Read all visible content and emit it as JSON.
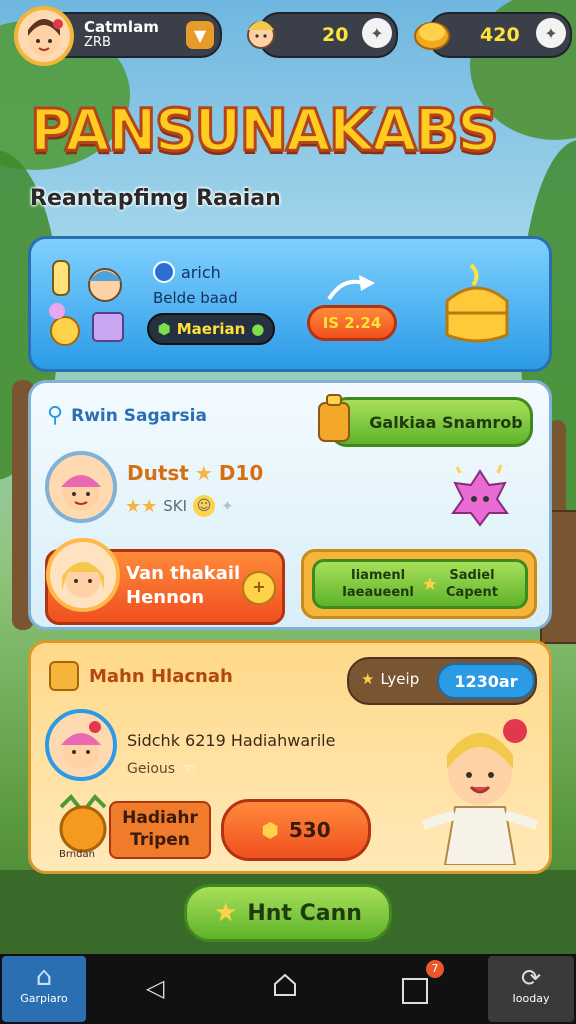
{
  "hud": {
    "player_name": "Catmlam",
    "player_sub": "ZRB",
    "counter1_value": "20",
    "counter2_value": "420"
  },
  "title": "PANSUNAKABS",
  "subtitle": "Reantapfimg Raaian",
  "panel1": {
    "label1": "arich",
    "label2": "Belde baad",
    "badge_label": "Maerian",
    "price_label": "IS 2.24"
  },
  "panel2": {
    "heading": "Rwin Sagarsia",
    "green_button": "Galkiaa Snamrob",
    "player_name": "Dutst",
    "player_level": "D10",
    "player_small": "SKI",
    "orange_card_line1": "Van thakail",
    "orange_card_line2": "Hennon",
    "dual_btn_left_line1": "Iiamenl",
    "dual_btn_left_line2": "Iaeaueenl",
    "dual_btn_right_line1": "Sadiel",
    "dual_btn_right_line2": "Capent"
  },
  "panel3": {
    "heading": "Mahn Hlacnah",
    "pill_left": "Lyeip",
    "pill_right": "1230ar",
    "line1": "Sidchk 6219 Hadiahwarile",
    "line2": "Geious",
    "coin_label": "Brndan",
    "reward_line1": "Hadiahr",
    "reward_line2": "Tripen",
    "reward_value": "530"
  },
  "big_button": "Hnt Cann",
  "navbar": {
    "left_label": "Garpiaro",
    "right_label": "Iooday",
    "badge": "7"
  },
  "colors": {
    "accent_blue": "#2b9be6",
    "accent_orange": "#f0501f",
    "accent_green": "#5fb32b",
    "accent_gold": "#f5b43a"
  }
}
